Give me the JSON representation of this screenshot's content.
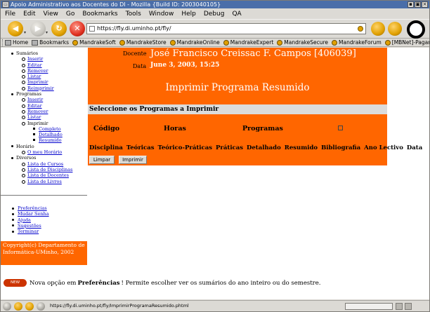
{
  "window": {
    "title": "Apoio Administrativo aos Docentes do DI - Mozilla {Build ID: 2003040105}"
  },
  "menu": [
    "File",
    "Edit",
    "View",
    "Go",
    "Bookmarks",
    "Tools",
    "Window",
    "Help",
    "Debug",
    "QA"
  ],
  "nav": {
    "url": "https://fly.di.uminho.pt/fly/"
  },
  "bookmarks": [
    "Home",
    "Bookmarks",
    "MandrakeSoft",
    "MandrakeStore",
    "MandrakeOnline",
    "MandrakeExpert",
    "MandrakeSecure",
    "MandrakeForum",
    "[MBNet]-Pagam..."
  ],
  "sidebar": {
    "sections": [
      {
        "label": "Sumários",
        "items": [
          "Inserir",
          "Editar",
          "Remover",
          "Listar",
          "Imprimir",
          "Reimprimir"
        ]
      },
      {
        "label": "Programas",
        "items": [
          "Inserir",
          "Editar",
          "Remover",
          "Listar",
          "Imprimir"
        ],
        "subitems": [
          "Completo",
          "Detalhado",
          "Resumido"
        ]
      },
      {
        "label": "Horário",
        "items": [
          "O meu Horário"
        ]
      },
      {
        "label": "Diversos",
        "items": [
          "Lista de Cursos",
          "Lista de Disciplinas",
          "Lista de Docentes",
          "Lista de Livros"
        ]
      }
    ],
    "bottom_links": [
      "Preferências",
      "Mudar Senha",
      "Ajuda",
      "Sugestões",
      "Terminar"
    ],
    "copyright": "Copyright(c) Departamento de Informática-UMinho, 2002"
  },
  "main": {
    "docente_label": "Docente",
    "docente_value": "José Francisco Creissac F. Campos [406039]",
    "data_label": "Data",
    "data_value": "June 3, 2003, 15:25",
    "title": "Imprimir Programa Resumido",
    "select_bar": "Seleccione os Programas a Imprimir",
    "header_codigo": "Código",
    "header_horas": "Horas",
    "header_programas": "Programas",
    "columns": [
      "Disciplina",
      "Teóricas",
      "Teórico-Práticas",
      "Práticas",
      "Detalhado",
      "Resumido",
      "Bibliografia",
      "Ano Lectivo",
      "Data"
    ],
    "btn_limpar": "Limpar",
    "btn_imprimir": "Imprimir"
  },
  "news": {
    "badge": "NEW",
    "prefix": "Nova opção em",
    "highlight": "Preferências",
    "suffix": "! Permite escolher ver os sumários do ano inteiro ou do semestre."
  },
  "status": {
    "url": "https://fly.di.uminho.pt/fly/ImprimirProgramaResumido.phtml"
  },
  "colors": {
    "accent": "#ff6600",
    "title_bar": "#4a6ea9",
    "link": "#0000cc"
  }
}
